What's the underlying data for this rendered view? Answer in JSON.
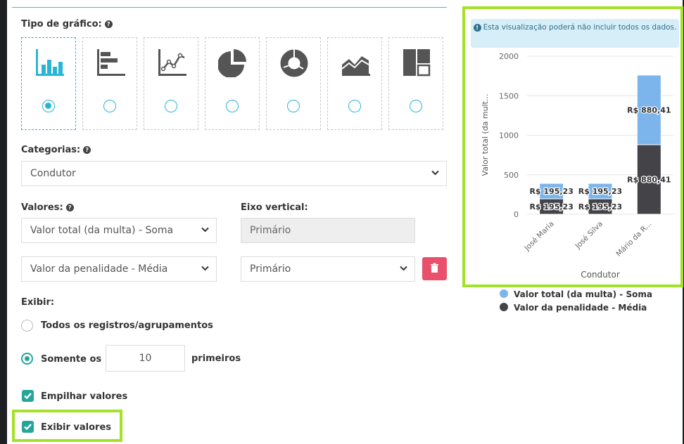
{
  "chart_type_section": {
    "label": "Tipo de gráfico:",
    "types": [
      {
        "icon": "bar-chart-icon",
        "selected": true
      },
      {
        "icon": "horizontal-bar-chart-icon",
        "selected": false
      },
      {
        "icon": "line-chart-icon",
        "selected": false
      },
      {
        "icon": "pie-chart-icon",
        "selected": false
      },
      {
        "icon": "donut-chart-icon",
        "selected": false
      },
      {
        "icon": "area-chart-icon",
        "selected": false
      },
      {
        "icon": "treemap-icon",
        "selected": false
      }
    ]
  },
  "categories": {
    "label": "Categorias:",
    "selected": "Condutor"
  },
  "values_section": {
    "label": "Valores:",
    "axis_label": "Eixo vertical:",
    "rows": [
      {
        "value": "Valor total (da multa) - Soma",
        "axis": "Primário",
        "axis_disabled": true
      },
      {
        "value": "Valor da penalidade - Média",
        "axis": "Primário",
        "axis_disabled": false
      }
    ]
  },
  "display": {
    "label": "Exibir:",
    "option_all": "Todos os registros/agrupamentos",
    "option_top": "Somente os",
    "top_count": "10",
    "top_suffix": "primeiros",
    "selected": "top"
  },
  "stack_values": {
    "label": "Empilhar valores",
    "checked": true
  },
  "show_values": {
    "label": "Exibir valores",
    "checked": true
  },
  "preview": {
    "notice": "Esta visualização poderá não incluir todos os dados."
  },
  "colors": {
    "accent": "#29b6d6",
    "series1": "#7cb5ec",
    "series2": "#434348",
    "highlight": "#a4e12a",
    "danger": "#e9506b",
    "check": "#26a69a"
  },
  "chart_data": {
    "type": "bar",
    "stacked": true,
    "categories": [
      "José Maria",
      "José Silva",
      "Mário da R..."
    ],
    "series": [
      {
        "name": "Valor total (da multa) - Soma",
        "values": [
          195.23,
          195.23,
          880.41
        ],
        "labels": [
          "R$ 195,23",
          "R$ 195,23",
          "R$ 880,41"
        ]
      },
      {
        "name": "Valor da penalidade - Média",
        "values": [
          195.23,
          195.23,
          880.41
        ],
        "labels": [
          "R$ 195,23",
          "R$ 195,23",
          "R$ 880,41"
        ]
      }
    ],
    "yticks": [
      "0",
      "500",
      "1000",
      "1500",
      "2000"
    ],
    "ylim": [
      0,
      2000
    ],
    "ylabel": "Valor total (da mult...",
    "xlabel": "Condutor",
    "grid": true,
    "legend": "bottom"
  }
}
